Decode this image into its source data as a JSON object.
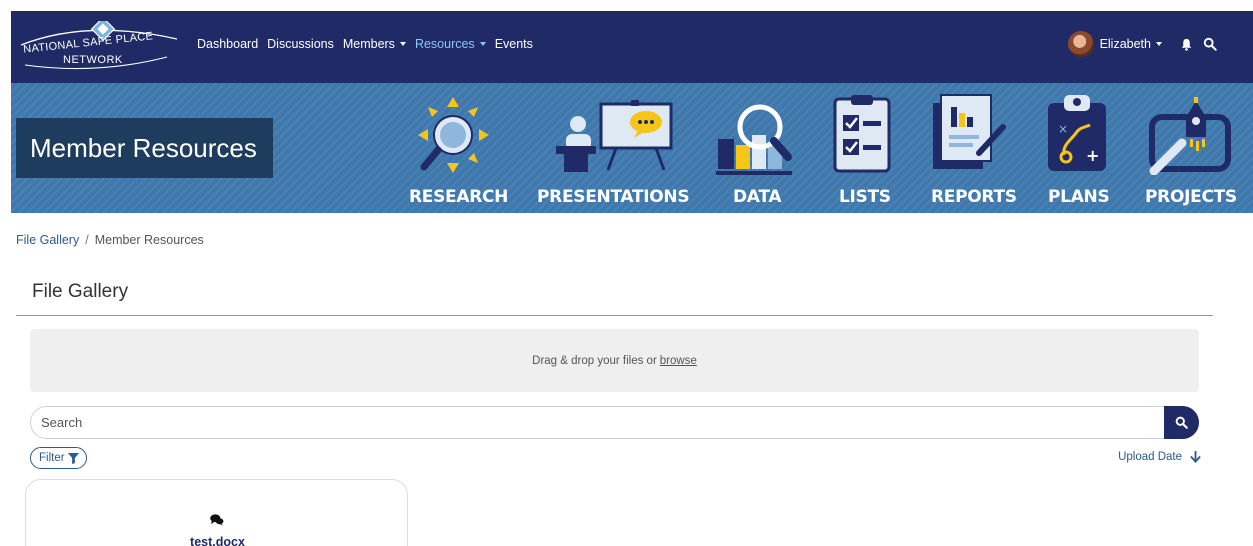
{
  "brand": {
    "line1": "NATIONAL SAFE PLACE",
    "line2": "NETWORK"
  },
  "nav": {
    "dashboard": "Dashboard",
    "discussions": "Discussions",
    "members": "Members",
    "resources": "Resources",
    "events": "Events"
  },
  "user": {
    "name": "Elizabeth"
  },
  "banner": {
    "title": "Member Resources",
    "categories": {
      "research": "RESEARCH",
      "presentations": "PRESENTATIONS",
      "data": "DATA",
      "lists": "LISTS",
      "reports": "REPORTS",
      "plans": "PLANS",
      "projects": "PROJECTS"
    }
  },
  "breadcrumb": {
    "parent": "File Gallery",
    "separator": "/",
    "current": "Member Resources"
  },
  "page": {
    "title": "File Gallery"
  },
  "dropzone": {
    "text": "Drag & drop your files or",
    "browse": "browse"
  },
  "search": {
    "placeholder": "Search"
  },
  "filter": {
    "label": "Filter"
  },
  "sort": {
    "label": "Upload Date"
  },
  "files": [
    {
      "name": "test.docx"
    }
  ],
  "colors": {
    "navy": "#1f2a66",
    "banner": "#3f78ad",
    "accent_yellow": "#f5c518",
    "link": "#2b5a8f"
  }
}
